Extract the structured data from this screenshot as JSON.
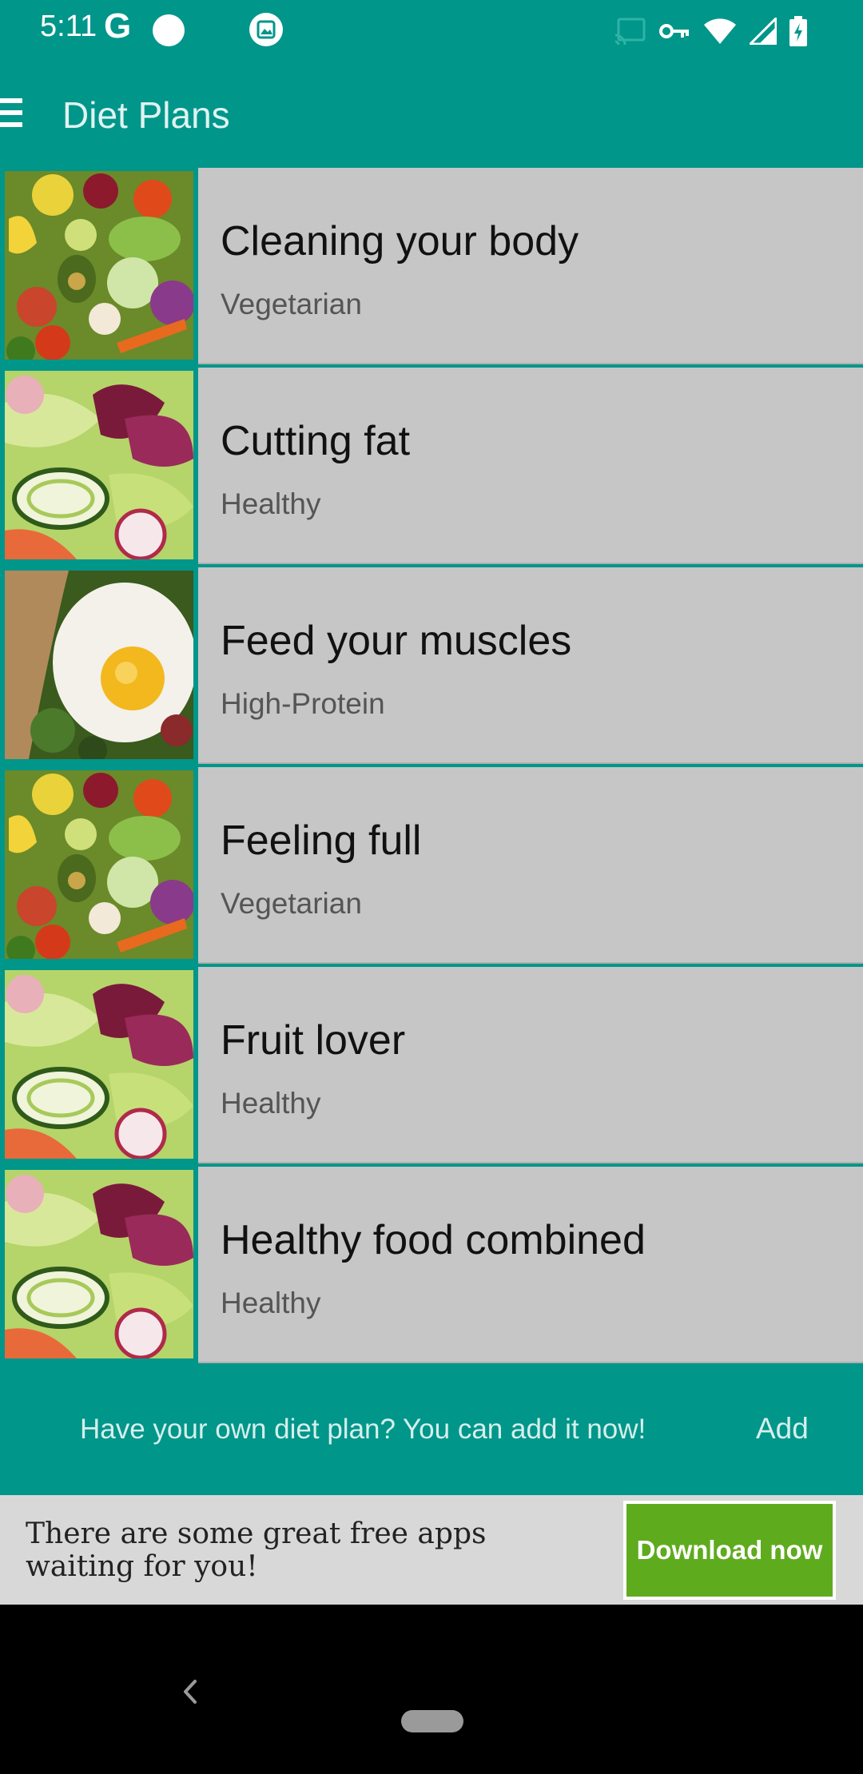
{
  "status_bar": {
    "time": "5:11",
    "carrier_glyph": "G",
    "icons": [
      "google-icon",
      "notification-dot-icon",
      "photo-icon",
      "cast-icon",
      "vpn-key-icon",
      "wifi-icon",
      "signal-icon",
      "battery-charging-icon"
    ]
  },
  "app_bar": {
    "title": "Diet Plans",
    "menu_icon": "hamburger-menu-icon"
  },
  "diet_plans": [
    {
      "title": "Cleaning your body",
      "category": "Vegetarian",
      "thumbnail": "fruit-vegetable-pile-image"
    },
    {
      "title": "Cutting fat",
      "category": "Healthy",
      "thumbnail": "salad-image"
    },
    {
      "title": "Feed your muscles",
      "category": "High-Protein",
      "thumbnail": "fried-egg-image"
    },
    {
      "title": "Feeling full",
      "category": "Vegetarian",
      "thumbnail": "fruit-vegetable-pile-image"
    },
    {
      "title": "Fruit lover",
      "category": "Healthy",
      "thumbnail": "salad-image"
    },
    {
      "title": "Healthy food combined",
      "category": "Healthy",
      "thumbnail": "salad-image"
    }
  ],
  "add_bar": {
    "prompt": "Have your own diet plan? You can add it now!",
    "add_label": "Add"
  },
  "ad_banner": {
    "text": "There are some great free apps waiting for you!",
    "button_label": "Download now",
    "button_color": "#5fab1e"
  },
  "theme": {
    "primary": "#00968a",
    "list_item_bg": "#c6c6c6"
  }
}
